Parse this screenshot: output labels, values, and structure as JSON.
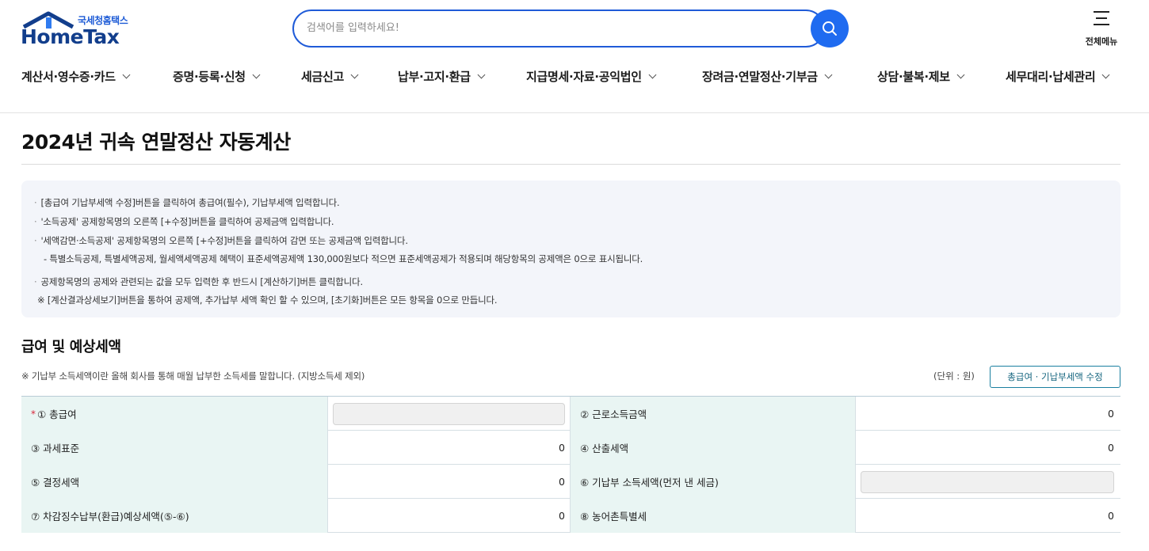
{
  "header": {
    "logo_small": "국세청홈택스",
    "logo_big": "HomeTax",
    "search_placeholder": "검색어를 입력하세요!",
    "all_menu_label": "전체메뉴"
  },
  "nav": [
    "계산서·영수증·카드",
    "증명·등록·신청",
    "세금신고",
    "납부·고지·환급",
    "지급명세·자료·공익법인",
    "장려금·연말정산·기부금",
    "상담·불복·제보",
    "세무대리·납세관리"
  ],
  "page_title": "2024년 귀속 연말정산 자동계산",
  "notice": {
    "line1": "[총급여 기납부세액 수정]버튼을 클릭하여 총급여(필수), 기납부세액 입력합니다.",
    "line2": "'소득공제' 공제항목명의 오른쪽 [+수정]버튼을 클릭하여 공제금액 입력합니다.",
    "line3": "'세액감면·소득공제' 공제항목명의 오른쪽 [+수정]버튼을 클릭하여 감면 또는 공제금액 입력합니다.",
    "line4": "- 특별소득공제, 특별세액공제, 월세액세액공제 혜택이 표준세액공제액 130,000원보다 적으면 표준세액공제가 적용되며 해당항목의 공제액은 0으로 표시됩니다.",
    "line5": "공제항목명의 공제와 관련되는 값을 모두 입력한 후 반드시 [계산하기]버튼 클릭합니다.",
    "line6": "※ [계산결과상세보기]버튼을 통하여 공제액, 추가납부 세액 확인 할 수 있으며, [초기화]버튼은 모든 항목을 0으로 만듭니다."
  },
  "section": {
    "title": "급여 및 예상세액",
    "note": "※ 기납부 소득세액이란 올해 회사를 통해 매월 납부한 소득세를 말합니다. (지방소득세 제외)",
    "unit": "(단위 : 원)",
    "edit_button": "총급여 · 기납부세액 수정"
  },
  "table": {
    "r1": {
      "label1": "① 총급여",
      "label2": "② 근로소득금액",
      "value2": "0"
    },
    "r2": {
      "label1": "③ 과세표준",
      "value1": "0",
      "label2": "④ 산출세액",
      "value2": "0"
    },
    "r3": {
      "label1": "⑤ 결정세액",
      "value1": "0",
      "label2": "⑥ 기납부 소득세액(먼저 낸 세금)"
    },
    "r4": {
      "label1": "⑦ 차감징수납부(환급)예상세액(⑤-⑥)",
      "value1": "0",
      "label2": "⑧ 농어촌특별세",
      "value2": "0"
    },
    "required_mark": "*"
  },
  "colors": {
    "accent": "#1f6bf0",
    "logo_navy": "#123e8c",
    "table_header": "#e9f5f3",
    "button_teal": "#15657f"
  }
}
